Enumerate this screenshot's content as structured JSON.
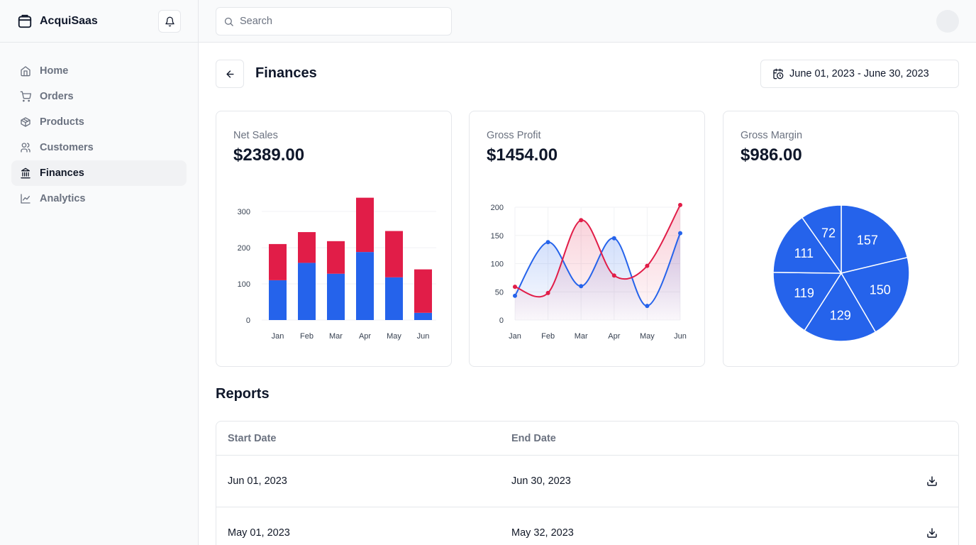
{
  "app": {
    "title": "AcquiSaas"
  },
  "sidebar": {
    "items": [
      {
        "label": "Home",
        "icon": "home-icon"
      },
      {
        "label": "Orders",
        "icon": "cart-icon"
      },
      {
        "label": "Products",
        "icon": "package-icon"
      },
      {
        "label": "Customers",
        "icon": "users-icon"
      },
      {
        "label": "Finances",
        "icon": "bank-icon",
        "active": true
      },
      {
        "label": "Analytics",
        "icon": "line-chart-icon"
      }
    ]
  },
  "search": {
    "placeholder": "Search"
  },
  "page": {
    "title": "Finances",
    "date_range": "June 01, 2023 - June 30, 2023"
  },
  "cards": [
    {
      "label": "Net Sales",
      "value": "$2389.00"
    },
    {
      "label": "Gross Profit",
      "value": "$1454.00"
    },
    {
      "label": "Gross Margin",
      "value": "$986.00"
    }
  ],
  "colors": {
    "blue": "#2563eb",
    "red": "#e11d48",
    "border": "#e5e7eb",
    "muted": "#6b7280"
  },
  "chart_data": [
    {
      "type": "bar",
      "stacked": true,
      "categories": [
        "Jan",
        "Feb",
        "Mar",
        "Apr",
        "May",
        "Jun"
      ],
      "series": [
        {
          "color": "#2563eb",
          "values": [
            110,
            158,
            128,
            188,
            118,
            20
          ]
        },
        {
          "color": "#e11d48",
          "values": [
            100,
            85,
            90,
            150,
            128,
            120
          ]
        }
      ],
      "ylim": [
        0,
        300
      ],
      "yticks": [
        0,
        100,
        200,
        300
      ],
      "grid": true
    },
    {
      "type": "area",
      "categories": [
        "Jan",
        "Feb",
        "Mar",
        "Apr",
        "May",
        "Jun"
      ],
      "series": [
        {
          "color": "#2563eb",
          "values": [
            43,
            138,
            60,
            145,
            25,
            154
          ]
        },
        {
          "color": "#e11d48",
          "values": [
            59,
            48,
            177,
            79,
            96,
            204
          ]
        }
      ],
      "ylim": [
        0,
        200
      ],
      "yticks": [
        0,
        50,
        100,
        150,
        200
      ],
      "grid": true
    },
    {
      "type": "pie",
      "values": [
        157,
        150,
        129,
        119,
        111,
        72
      ],
      "labels": [
        "157",
        "150",
        "129",
        "119",
        "111",
        "72"
      ],
      "color": "#2563eb"
    }
  ],
  "reports": {
    "title": "Reports",
    "columns": [
      "Start Date",
      "End Date"
    ],
    "rows": [
      {
        "start": "Jun 01, 2023",
        "end": "Jun 30, 2023"
      },
      {
        "start": "May 01, 2023",
        "end": "May 32, 2023"
      }
    ]
  }
}
